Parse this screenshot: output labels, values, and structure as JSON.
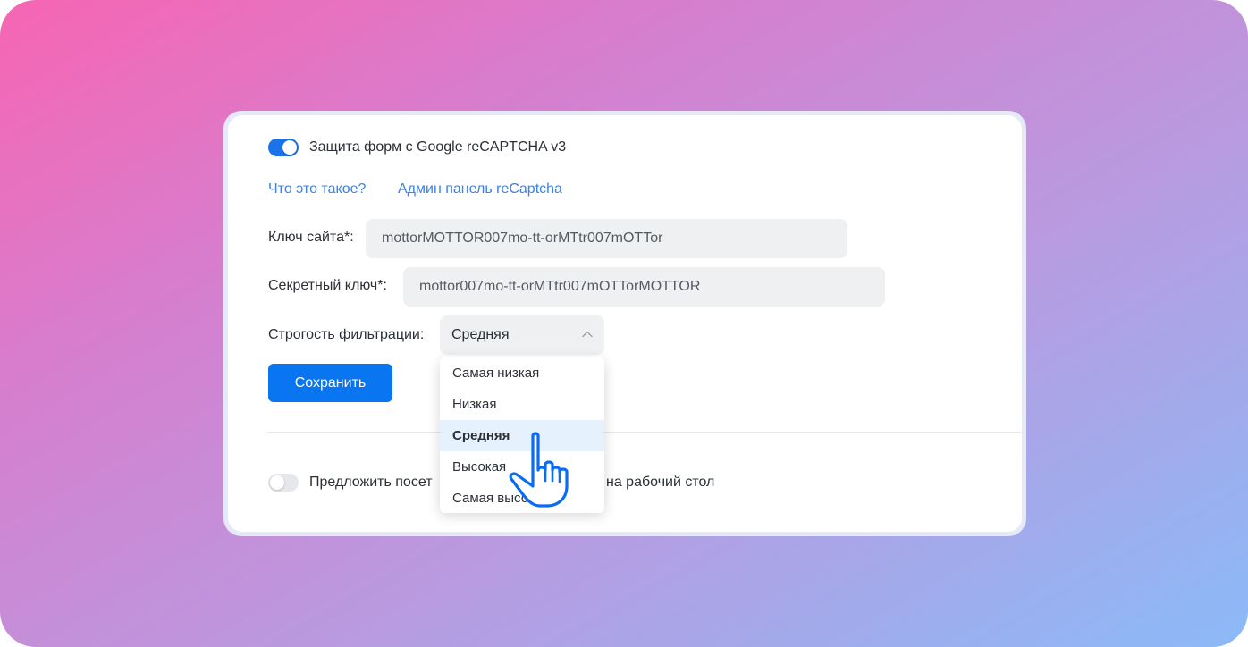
{
  "recaptcha": {
    "toggle_label": "Защита форм с Google reCAPTCHA v3",
    "enabled": true,
    "links": {
      "what_is_it": "Что это такое?",
      "admin_panel": "Админ панель reCaptcha"
    },
    "site_key": {
      "label": "Ключ сайта*:",
      "value": "mottorMOTTOR007mo-tt-orMTtr007mOTTor"
    },
    "secret_key": {
      "label": "Секретный ключ*:",
      "value": "mottor007mo-tt-orMTtr007mOTTorMOTTOR"
    },
    "filter": {
      "label": "Строгость фильтрации:",
      "selected": "Средняя",
      "options": [
        {
          "label": "Самая низкая"
        },
        {
          "label": "Низкая"
        },
        {
          "label": "Средняя"
        },
        {
          "label": "Высокая"
        },
        {
          "label": "Самая высокая"
        }
      ]
    },
    "save_button": "Сохранить"
  },
  "desktop_offer": {
    "label_start": "Предложить посет",
    "label_end": "на рабочий стол",
    "enabled": false
  },
  "icons": {
    "chevron": "chevron-up-icon",
    "cursor": "hand-pointer-icon"
  },
  "colors": {
    "accent": "#1a73e8",
    "button": "#0a75f0",
    "link": "#3b82e6",
    "selected_option_bg": "#e5f1fc",
    "gradient_start": "#f765b2",
    "gradient_end": "#8bbaf7"
  }
}
